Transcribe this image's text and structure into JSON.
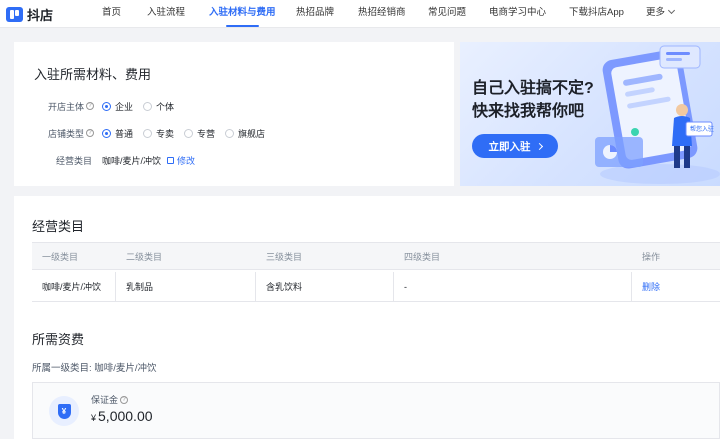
{
  "nav": {
    "logo_text": "抖店",
    "items": [
      {
        "label": "首页"
      },
      {
        "label": "入驻流程"
      },
      {
        "label": "入驻材料与费用"
      },
      {
        "label": "热招品牌"
      },
      {
        "label": "热招经销商"
      },
      {
        "label": "常见问题"
      },
      {
        "label": "电商学习中心"
      },
      {
        "label": "下载抖店App"
      },
      {
        "label": "更多"
      }
    ],
    "active_item": "入驻材料与费用",
    "accent_color": "#2f6df6"
  },
  "form": {
    "title": "入驻所需材料、费用",
    "entity": {
      "label": "开店主体",
      "options": [
        "企业",
        "个体"
      ],
      "selected": "企业"
    },
    "store_type": {
      "label": "店铺类型",
      "options": [
        "普通",
        "专卖",
        "专营",
        "旗舰店"
      ],
      "selected": "普通"
    },
    "category": {
      "label": "经营类目",
      "value": "咖啡/麦片/冲饮",
      "edit_label": "修改"
    }
  },
  "banner": {
    "line1": "自己入驻搞不定?",
    "line2": "快来找我帮你吧",
    "button_label": "立即入驻",
    "figure_tag": "帮您入驻"
  },
  "category_section": {
    "title": "经营类目",
    "columns": [
      "一级类目",
      "二级类目",
      "三级类目",
      "四级类目",
      "操作"
    ],
    "rows": [
      {
        "c1": "咖啡/麦片/冲饮",
        "c2": "乳制品",
        "c3": "含乳饮料",
        "c4": "-",
        "action": "删除"
      }
    ]
  },
  "fee_section": {
    "title": "所需资费",
    "category_prefix": "所属一级类目:",
    "category_value": "咖啡/麦片/冲饮",
    "deposit_label": "保证金",
    "currency_symbol": "¥",
    "deposit_amount": "5,000.00",
    "deposit_icon_glyph": "¥"
  }
}
